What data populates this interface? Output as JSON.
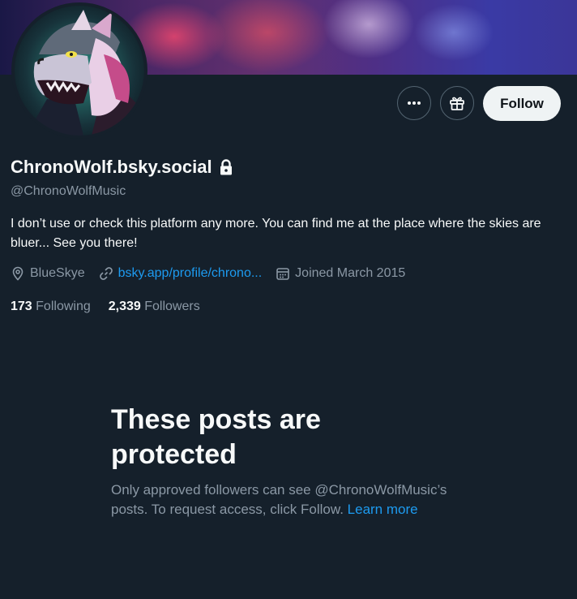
{
  "profile": {
    "display_name": "ChronoWolf.bsky.social",
    "handle": "@ChronoWolfMusic",
    "bio": "I don’t use or check this platform any more. You can find me at the place where the skies are bluer... See you there!",
    "location": "BlueSkye",
    "link": "bsky.app/profile/chrono...",
    "joined": "Joined March 2015",
    "following_count": "173",
    "following_label": "Following",
    "followers_count": "2,339",
    "followers_label": "Followers"
  },
  "actions": {
    "follow_label": "Follow",
    "more_icon": "more-icon",
    "gift_icon": "gift-icon"
  },
  "protected": {
    "title": "These posts are protected",
    "body": "Only approved followers can see @ChronoWolfMusic’s posts. To request access, click Follow.",
    "learn_more": "Learn more"
  },
  "colors": {
    "background": "#15202b",
    "accent": "#1d9bf0",
    "secondary_text": "#8b98a5",
    "follow_button": "#eff3f4"
  }
}
